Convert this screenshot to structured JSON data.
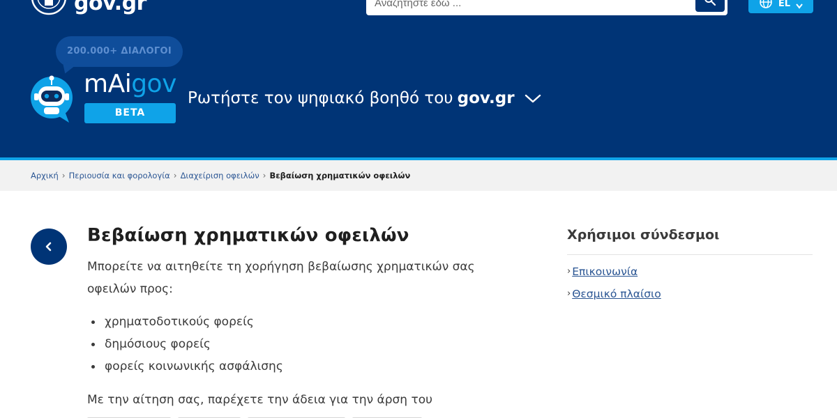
{
  "header": {
    "logo_text": "gov.gr",
    "search": {
      "placeholder": "Αναζητήστε εδώ ..."
    },
    "language_label": "EL"
  },
  "assistant": {
    "bubble_text": "200.000+ ΔΙΑΛΟΓΟΙ",
    "brand_prefix": "mAi",
    "brand_suffix": "gov",
    "beta_label": "BETA",
    "tagline_text": "Ρωτήστε τον ψηφιακό βοηθό του",
    "tagline_bold": "gov.gr"
  },
  "breadcrumb": {
    "items": [
      "Αρχική",
      "Περιουσία και φορολογία",
      "Διαχείριση οφειλών"
    ],
    "current": "Βεβαίωση χρηματικών οφειλών"
  },
  "main": {
    "title": "Βεβαίωση χρηματικών οφειλών",
    "intro": "Μπορείτε να αιτηθείτε τη χορήγηση βεβαίωσης χρηματικών σας οφειλών προς:",
    "bullets": [
      "χρηματοδοτικούς φορείς",
      "δημόσιους φορείς",
      "φορείς κοινωνικής ασφάλισης"
    ],
    "paragraph2": "Με την αίτηση σας, παρέχετε την άδεια για την άρση του"
  },
  "sidebar": {
    "heading": "Χρήσιμοι σύνδεσμοι",
    "links": [
      "Επικοινωνία",
      "Θεσμικό πλαίσιο"
    ]
  },
  "colors": {
    "header_bg": "#003476",
    "accent": "#0fa3e8",
    "link": "#2a5593"
  }
}
